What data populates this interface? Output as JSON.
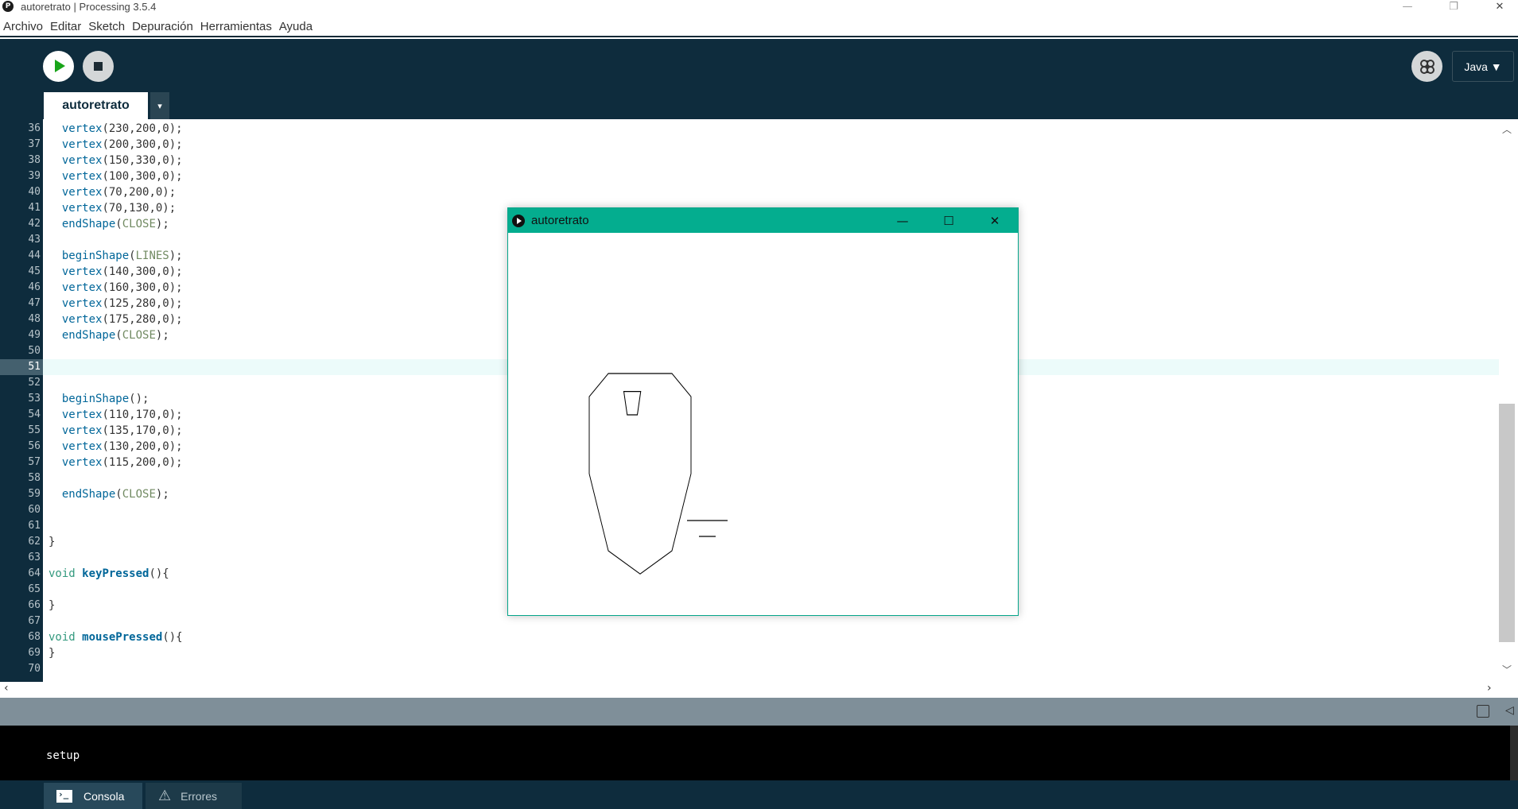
{
  "window": {
    "title": "autoretrato | Processing 3.5.4",
    "app_icon": "processing-icon",
    "minimize": "—",
    "maximize": "❐",
    "close": "✕"
  },
  "menu": [
    "Archivo",
    "Editar",
    "Sketch",
    "Depuración",
    "Herramientas",
    "Ayuda"
  ],
  "toolbar": {
    "run_icon": "play-icon",
    "stop_icon": "stop-icon",
    "debug_icon": "butterfly-icon",
    "mode_label": "Java ▼"
  },
  "tabs": {
    "active": "autoretrato",
    "menu_arrow": "▾"
  },
  "editor": {
    "current_line": 51,
    "lines": [
      {
        "n": "36",
        "code": [
          {
            "t": "  "
          },
          {
            "t": "vertex",
            "c": "kw-fn"
          },
          {
            "t": "(230,200,0);"
          }
        ]
      },
      {
        "n": "37",
        "code": [
          {
            "t": "  "
          },
          {
            "t": "vertex",
            "c": "kw-fn"
          },
          {
            "t": "(200,300,0);"
          }
        ]
      },
      {
        "n": "38",
        "code": [
          {
            "t": "  "
          },
          {
            "t": "vertex",
            "c": "kw-fn"
          },
          {
            "t": "(150,330,0);"
          }
        ]
      },
      {
        "n": "39",
        "code": [
          {
            "t": "  "
          },
          {
            "t": "vertex",
            "c": "kw-fn"
          },
          {
            "t": "(100,300,0);"
          }
        ]
      },
      {
        "n": "40",
        "code": [
          {
            "t": "  "
          },
          {
            "t": "vertex",
            "c": "kw-fn"
          },
          {
            "t": "(70,200,0);"
          }
        ]
      },
      {
        "n": "41",
        "code": [
          {
            "t": "  "
          },
          {
            "t": "vertex",
            "c": "kw-fn"
          },
          {
            "t": "(70,130,0);"
          }
        ]
      },
      {
        "n": "42",
        "code": [
          {
            "t": "  "
          },
          {
            "t": "endShape",
            "c": "kw-fn"
          },
          {
            "t": "("
          },
          {
            "t": "CLOSE",
            "c": "kw-const"
          },
          {
            "t": ");"
          }
        ]
      },
      {
        "n": "43",
        "code": []
      },
      {
        "n": "44",
        "code": [
          {
            "t": "  "
          },
          {
            "t": "beginShape",
            "c": "kw-fn"
          },
          {
            "t": "("
          },
          {
            "t": "LINES",
            "c": "kw-const"
          },
          {
            "t": ");"
          }
        ]
      },
      {
        "n": "45",
        "code": [
          {
            "t": "  "
          },
          {
            "t": "vertex",
            "c": "kw-fn"
          },
          {
            "t": "(140,300,0);"
          }
        ]
      },
      {
        "n": "46",
        "code": [
          {
            "t": "  "
          },
          {
            "t": "vertex",
            "c": "kw-fn"
          },
          {
            "t": "(160,300,0);"
          }
        ]
      },
      {
        "n": "47",
        "code": [
          {
            "t": "  "
          },
          {
            "t": "vertex",
            "c": "kw-fn"
          },
          {
            "t": "(125,280,0);"
          }
        ]
      },
      {
        "n": "48",
        "code": [
          {
            "t": "  "
          },
          {
            "t": "vertex",
            "c": "kw-fn"
          },
          {
            "t": "(175,280,0);"
          }
        ]
      },
      {
        "n": "49",
        "code": [
          {
            "t": "  "
          },
          {
            "t": "endShape",
            "c": "kw-fn"
          },
          {
            "t": "("
          },
          {
            "t": "CLOSE",
            "c": "kw-const"
          },
          {
            "t": ");"
          }
        ]
      },
      {
        "n": "50",
        "code": []
      },
      {
        "n": "51",
        "code": []
      },
      {
        "n": "52",
        "code": []
      },
      {
        "n": "53",
        "code": [
          {
            "t": "  "
          },
          {
            "t": "beginShape",
            "c": "kw-fn"
          },
          {
            "t": "();"
          }
        ]
      },
      {
        "n": "54",
        "code": [
          {
            "t": "  "
          },
          {
            "t": "vertex",
            "c": "kw-fn"
          },
          {
            "t": "(110,170,0);"
          }
        ]
      },
      {
        "n": "55",
        "code": [
          {
            "t": "  "
          },
          {
            "t": "vertex",
            "c": "kw-fn"
          },
          {
            "t": "(135,170,0);"
          }
        ]
      },
      {
        "n": "56",
        "code": [
          {
            "t": "  "
          },
          {
            "t": "vertex",
            "c": "kw-fn"
          },
          {
            "t": "(130,200,0);"
          }
        ]
      },
      {
        "n": "57",
        "code": [
          {
            "t": "  "
          },
          {
            "t": "vertex",
            "c": "kw-fn"
          },
          {
            "t": "(115,200,0);"
          }
        ]
      },
      {
        "n": "58",
        "code": []
      },
      {
        "n": "59",
        "code": [
          {
            "t": "  "
          },
          {
            "t": "endShape",
            "c": "kw-fn"
          },
          {
            "t": "("
          },
          {
            "t": "CLOSE",
            "c": "kw-const"
          },
          {
            "t": ");"
          }
        ]
      },
      {
        "n": "60",
        "code": []
      },
      {
        "n": "61",
        "code": []
      },
      {
        "n": "62",
        "code": [
          {
            "t": "}"
          }
        ]
      },
      {
        "n": "63",
        "code": []
      },
      {
        "n": "64",
        "code": [
          {
            "t": "void",
            "c": "kw-type"
          },
          {
            "t": " "
          },
          {
            "t": "keyPressed",
            "c": "kw-bold"
          },
          {
            "t": "(){"
          }
        ]
      },
      {
        "n": "65",
        "code": []
      },
      {
        "n": "66",
        "code": [
          {
            "t": "}"
          }
        ]
      },
      {
        "n": "67",
        "code": []
      },
      {
        "n": "68",
        "code": [
          {
            "t": "void",
            "c": "kw-type"
          },
          {
            "t": " "
          },
          {
            "t": "mousePressed",
            "c": "kw-bold"
          },
          {
            "t": "(){"
          }
        ]
      },
      {
        "n": "69",
        "code": [
          {
            "t": "}"
          }
        ]
      },
      {
        "n": "70",
        "code": []
      }
    ]
  },
  "console": {
    "output": "setup",
    "tabs": [
      {
        "label": "Consola",
        "icon": "terminal-icon"
      },
      {
        "label": "Errores",
        "icon": "warning-icon"
      }
    ]
  },
  "sketch_window": {
    "title": "autoretrato",
    "minimize": "—",
    "maximize": "☐",
    "close": "✕"
  },
  "colors": {
    "toolbar_bg": "#0e2c3d",
    "sketch_title_bg": "#04ad8f",
    "run_green": "#19a51a",
    "keyword_blue": "#006699",
    "constant_green": "#718a62"
  }
}
